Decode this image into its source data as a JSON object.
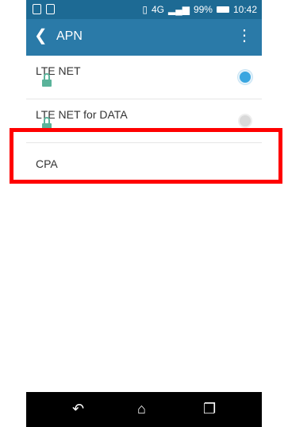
{
  "status_bar": {
    "battery": "99%",
    "time": "10:42",
    "network": "4G"
  },
  "toolbar": {
    "title": "APN",
    "back_icon": "arrow-left-icon",
    "menu_icon": "more-vertical-icon"
  },
  "apn_list": [
    {
      "name": "LTE NET",
      "selected": true,
      "locked": true
    },
    {
      "name": "LTE NET for DATA",
      "selected": false,
      "locked": true
    },
    {
      "name": "CPA",
      "selected": false,
      "locked": false
    }
  ],
  "highlight": {
    "target": "CPA",
    "color": "#ff0000"
  },
  "colors": {
    "status_bar": "#1d6a94",
    "toolbar": "#2a7aa8",
    "radio_selected": "#3aa6e0",
    "lock": "#5ab39a"
  },
  "nav_bar": {
    "icons": [
      "back-icon",
      "home-icon",
      "recent-apps-icon"
    ]
  }
}
